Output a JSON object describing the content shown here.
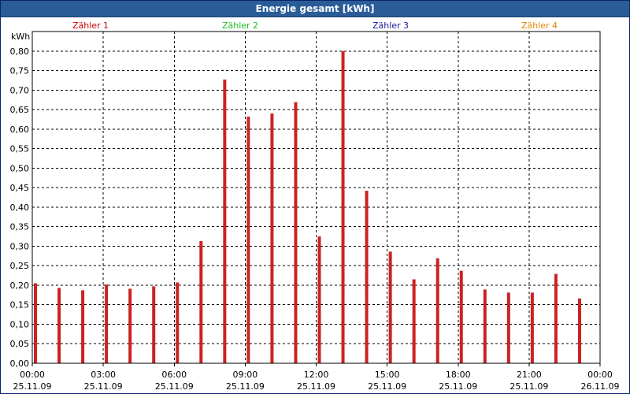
{
  "window": {
    "title": "Energie gesamt [kWh]"
  },
  "legend": [
    {
      "label": "Zähler 1",
      "color": "#cc0000"
    },
    {
      "label": "Zähler 2",
      "color": "#22bb22"
    },
    {
      "label": "Zähler 3",
      "color": "#1a1a99"
    },
    {
      "label": "Zähler 4",
      "color": "#dd8800"
    }
  ],
  "chart_data": {
    "type": "bar",
    "title": "Energie gesamt [kWh]",
    "ylabel": "kWh",
    "ylim": [
      0,
      0.85
    ],
    "yticks": [
      "0,00",
      "0,05",
      "0,10",
      "0,15",
      "0,20",
      "0,25",
      "0,30",
      "0,35",
      "0,40",
      "0,45",
      "0,50",
      "0,55",
      "0,60",
      "0,65",
      "0,70",
      "0,75",
      "0,80"
    ],
    "xticks": [
      {
        "time": "00:00",
        "date": "25.11.09"
      },
      {
        "time": "03:00",
        "date": "25.11.09"
      },
      {
        "time": "06:00",
        "date": "25.11.09"
      },
      {
        "time": "09:00",
        "date": "25.11.09"
      },
      {
        "time": "12:00",
        "date": "25.11.09"
      },
      {
        "time": "15:00",
        "date": "25.11.09"
      },
      {
        "time": "18:00",
        "date": "25.11.09"
      },
      {
        "time": "21:00",
        "date": "25.11.09"
      },
      {
        "time": "00:00",
        "date": "26.11.09"
      }
    ],
    "x_hours": [
      0,
      1,
      2,
      3,
      4,
      5,
      6,
      7,
      8,
      9,
      10,
      11,
      12,
      13,
      14,
      15,
      16,
      17,
      18,
      19,
      20,
      21,
      22,
      23
    ],
    "series": [
      {
        "name": "Zähler 1",
        "color": "#cc2222",
        "values": [
          0.205,
          0.193,
          0.187,
          0.202,
          0.191,
          0.197,
          0.207,
          0.313,
          0.727,
          0.632,
          0.64,
          0.669,
          0.325,
          0.8,
          0.442,
          0.286,
          0.215,
          0.269,
          0.237,
          0.189,
          0.181,
          0.181,
          0.229,
          0.166
        ]
      }
    ],
    "grid": true,
    "legend_position": "top"
  }
}
